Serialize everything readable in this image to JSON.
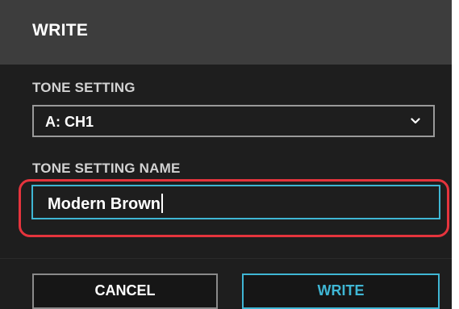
{
  "dialog": {
    "title": "WRITE",
    "tone_setting": {
      "label": "TONE SETTING",
      "selected": "A: CH1",
      "icon": "chevron-down-icon"
    },
    "tone_setting_name": {
      "label": "TONE SETTING NAME",
      "value": "Modern Brown"
    },
    "buttons": {
      "cancel": "CANCEL",
      "write": "WRITE"
    }
  },
  "colors": {
    "dialog_bg": "#1e1e1e",
    "titlebar_bg": "#3d3d3d",
    "accent": "#3fb6d4",
    "highlight_ring": "#e5343d"
  }
}
